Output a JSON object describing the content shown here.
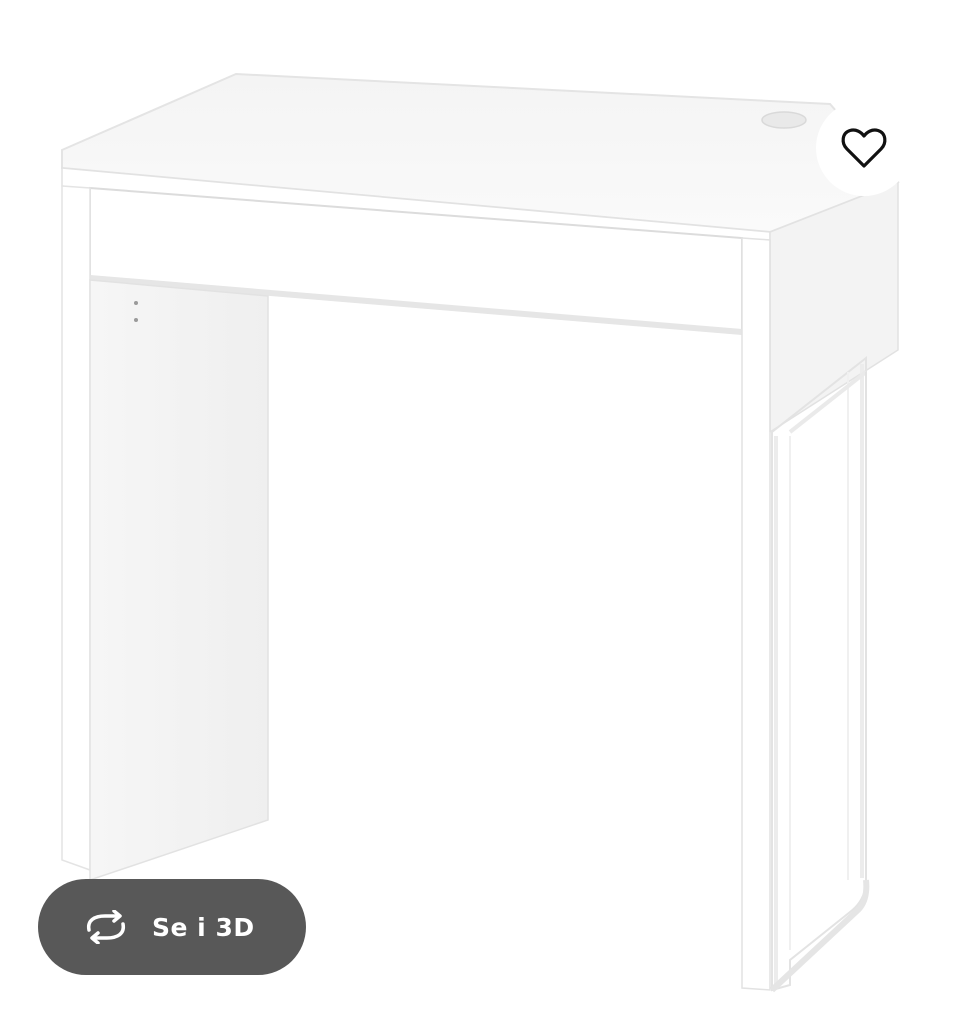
{
  "product": {
    "image_icon": "white-desk-product-photo"
  },
  "favorite": {
    "icon": "heart-icon"
  },
  "view_3d": {
    "icon": "rotate-arrows-icon",
    "label": "Se i 3D"
  },
  "colors": {
    "button_background": "#585858",
    "button_text": "#ffffff",
    "favorite_background": "#ffffff",
    "desk_white": "#ffffff",
    "desk_shadow": "#ececec"
  }
}
